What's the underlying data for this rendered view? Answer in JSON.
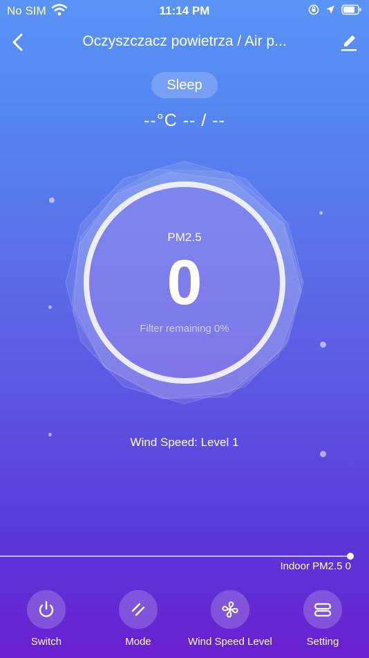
{
  "status_bar": {
    "carrier": "No SIM",
    "time": "11:14 PM",
    "icons": [
      "wifi-icon",
      "orientation-lock-icon",
      "location-icon",
      "battery-icon"
    ]
  },
  "nav": {
    "title": "Oczyszczacz powietrza / Air p...",
    "icons": [
      "back-icon",
      "edit-icon"
    ]
  },
  "mode": {
    "label": "Sleep"
  },
  "climate": {
    "temperature": "--°C -- / --"
  },
  "gauge": {
    "label": "PM2.5",
    "value": "0",
    "filter_text": "Filter remaining 0%"
  },
  "wind": {
    "text": "Wind Speed:  Level 1"
  },
  "chart": {
    "indoor_text": "Indoor PM2.5 0"
  },
  "toolbar": {
    "items": [
      {
        "label": "Switch",
        "icon": "power-icon"
      },
      {
        "label": "Mode",
        "icon": "mode-icon"
      },
      {
        "label": "Wind Speed Level",
        "icon": "fan-icon"
      },
      {
        "label": "Setting",
        "icon": "settings-icon"
      }
    ]
  },
  "colors": {
    "top": "#5a93f7",
    "middle": "#5c4fe0",
    "bottom": "#6a1fd0"
  }
}
